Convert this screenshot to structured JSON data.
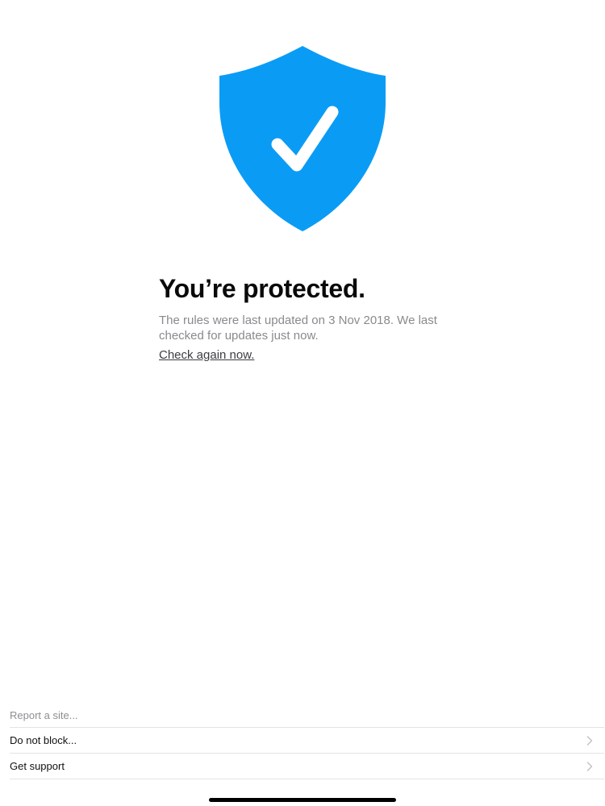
{
  "hero": {
    "shield_icon": "shield-check-icon",
    "shield_color": "#0a9cf5",
    "title": "You’re protected.",
    "description": "The rules were last updated on 3 Nov 2018. We last checked for updates just now.",
    "check_again_link": "Check again now."
  },
  "menu": {
    "items": [
      {
        "label": "Report a site...",
        "chevron_icon": ""
      },
      {
        "label": "Do not block...",
        "chevron_icon": "chevron-right-icon"
      },
      {
        "label": "Get support",
        "chevron_icon": "chevron-right-icon"
      }
    ]
  },
  "colors": {
    "accent": "#0a9cf5",
    "text_primary": "#0a0a0a",
    "text_secondary": "#8a8a8f"
  }
}
